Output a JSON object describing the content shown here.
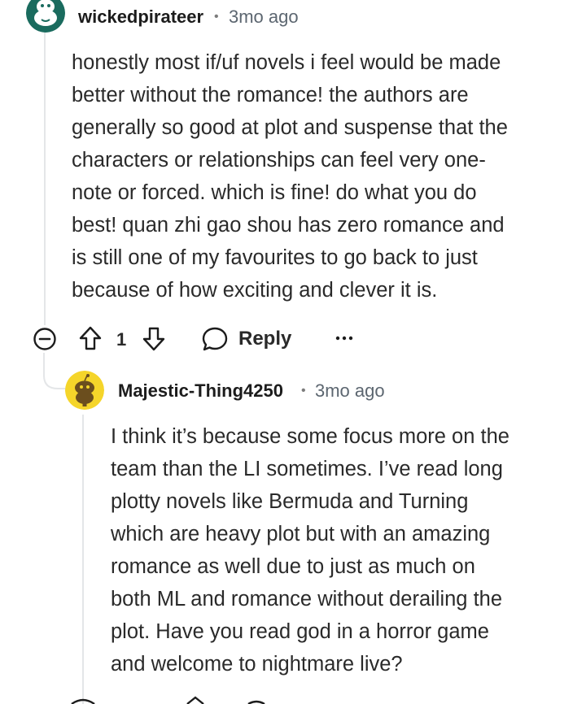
{
  "comment": {
    "username": "wickedpirateer",
    "separator": "•",
    "time_ago": "3mo ago",
    "body_lines": [
      "honestly most if/uf novels i feel would be made",
      "better without the romance! the authors are",
      "generally so good at plot and suspense that the",
      "characters or relationships can feel very one-",
      "note or forced. which is fine! do what you do",
      "best! quan zhi gao shou has zero romance and",
      "is still one of my favourites to go back to just",
      "because of how exciting and clever it is."
    ],
    "actions": {
      "vote_count": "1",
      "reply_label": "Reply",
      "more_label": "···"
    }
  },
  "reply": {
    "username": "Majestic-Thing4250",
    "separator": "•",
    "time_ago": "3mo ago",
    "body_lines": [
      "I think it’s because some focus more on the",
      "team than the LI sometimes. I’ve read long",
      "plotty novels like Bermuda and Turning",
      "which are heavy plot but with an amazing",
      "romance as well due to just as much on",
      "both ML and romance without derailing the",
      "plot. Have you read god in a horror game",
      "and welcome to nightmare live?"
    ]
  },
  "icons": {
    "collapse": "collapse-minus-icon",
    "upvote": "upvote-arrow-icon",
    "downvote": "downvote-arrow-icon",
    "reply": "speech-bubble-icon",
    "more": "more-dots-icon",
    "avatar_1": "snoo-avatar-icon",
    "avatar_2": "snoo-avatar-icon"
  },
  "colors": {
    "avatar_1_bg": "#1a6b5e",
    "avatar_2_bg": "#f5d52a",
    "text": "#2a2a2a",
    "meta": "#5c6670",
    "thread_line": "#e4e6e8"
  }
}
